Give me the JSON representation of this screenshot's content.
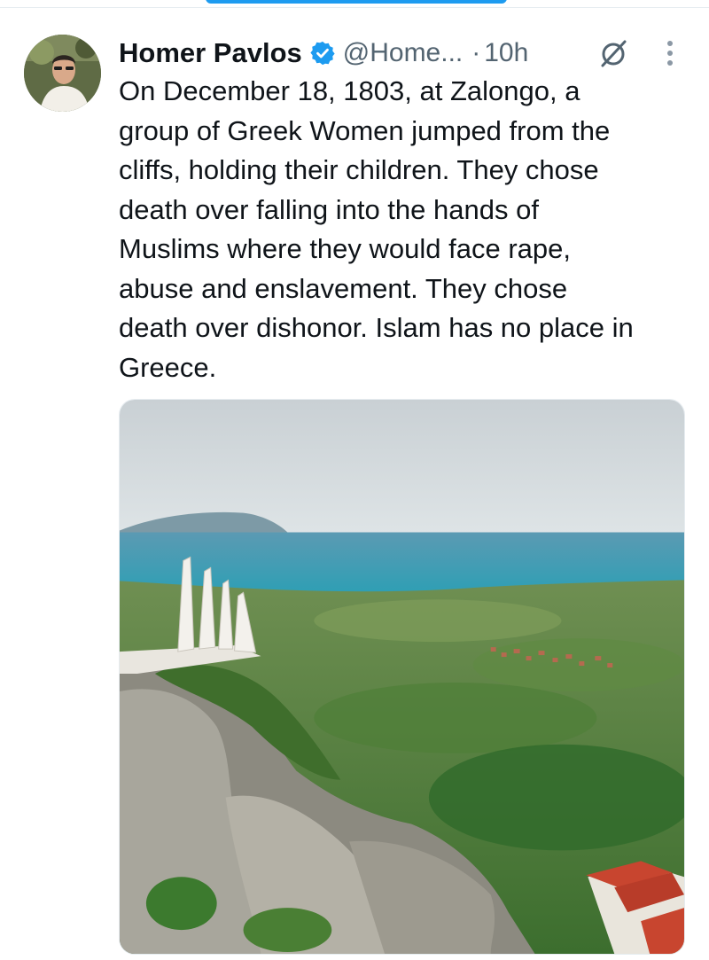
{
  "tweet": {
    "author_name": "Homer Pavlos",
    "author_handle": "@Home...",
    "separator": "·",
    "timestamp": "10h",
    "text_lines": [
      "On December 18, 1803, at Zalongo, a",
      "group of Greek Women jumped from the",
      "cliffs, holding their children. They chose",
      "death over falling into the hands of",
      "Muslims where they would face rape,",
      "abuse and enslavement. They chose",
      "death over dishonor. Islam has no place in",
      "Greece."
    ]
  },
  "icons": {
    "verified": "verified-badge-icon",
    "grok": "grok-icon",
    "more": "more-options-icon"
  },
  "colors": {
    "accent": "#1d9bf0",
    "text": "#0f1419",
    "secondary_text": "#536471"
  }
}
